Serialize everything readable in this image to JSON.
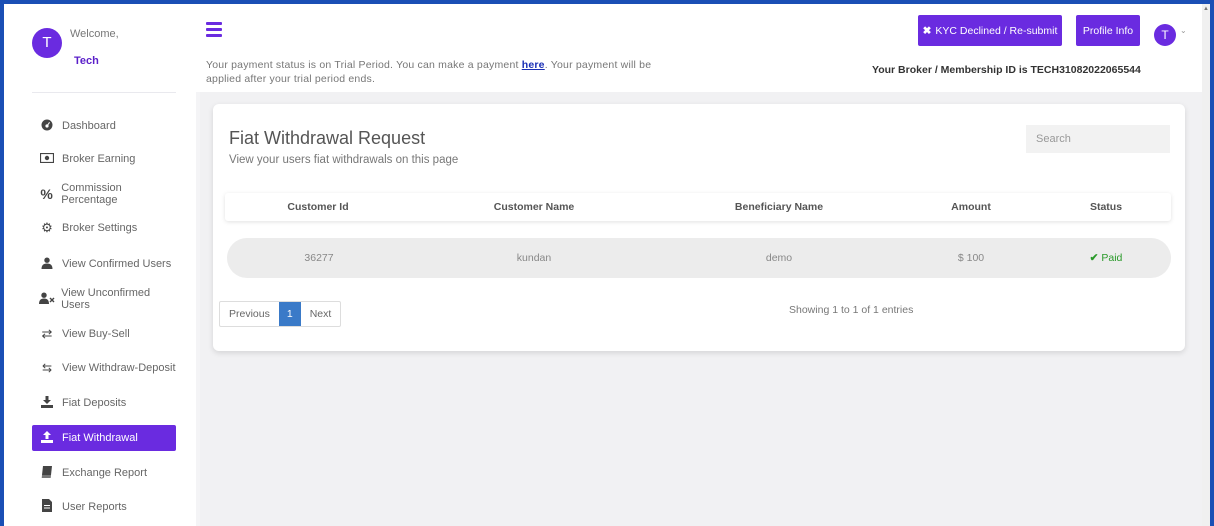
{
  "sidebar": {
    "avatar_letter": "T",
    "welcome": "Welcome,",
    "username": "Tech",
    "items": [
      {
        "label": "Dashboard",
        "icon": "dashboard-icon",
        "active": false
      },
      {
        "label": "Broker Earning",
        "icon": "money-icon",
        "active": false
      },
      {
        "label": "Commission Percentage",
        "icon": "percent-icon",
        "active": false
      },
      {
        "label": "Broker Settings",
        "icon": "gear-icon",
        "active": false
      },
      {
        "label": "View Confirmed Users",
        "icon": "user-icon",
        "active": false
      },
      {
        "label": "View Unconfirmed Users",
        "icon": "user-x-icon",
        "active": false
      },
      {
        "label": "View Buy-Sell",
        "icon": "exchange-icon",
        "active": false
      },
      {
        "label": "View Withdraw-Deposit",
        "icon": "transfer-icon",
        "active": false
      },
      {
        "label": "Fiat Deposits",
        "icon": "download-icon",
        "active": false
      },
      {
        "label": "Fiat Withdrawal",
        "icon": "upload-icon",
        "active": true
      },
      {
        "label": "Exchange Report",
        "icon": "book-icon",
        "active": false
      },
      {
        "label": "User Reports",
        "icon": "file-icon",
        "active": false
      }
    ]
  },
  "header": {
    "trial_before": "Your payment status is on Trial Period. You can make a payment ",
    "trial_link": "here",
    "trial_after": ". Your payment will be applied after your trial period ends.",
    "kyc_button": "KYC Declined / Re-submit",
    "profile_button": "Profile Info",
    "avatar_letter": "T",
    "broker_id": "Your Broker / Membership ID is TECH31082022065544"
  },
  "card": {
    "title": "Fiat Withdrawal Request",
    "subtitle": "View your users fiat withdrawals on this page",
    "search_placeholder": "Search",
    "columns": [
      "Customer Id",
      "Customer Name",
      "Beneficiary Name",
      "Amount",
      "Status"
    ],
    "rows": [
      {
        "customer_id": "36277",
        "customer_name": "kundan",
        "beneficiary": "demo",
        "amount": "$ 100",
        "status": "Paid"
      }
    ],
    "pagination": {
      "previous": "Previous",
      "current": "1",
      "next": "Next"
    },
    "showing": "Showing 1 to 1 of 1 entries"
  },
  "colors": {
    "accent": "#6a2be0",
    "paid": "#2a9a2a",
    "page_active": "#3a7ac8"
  }
}
